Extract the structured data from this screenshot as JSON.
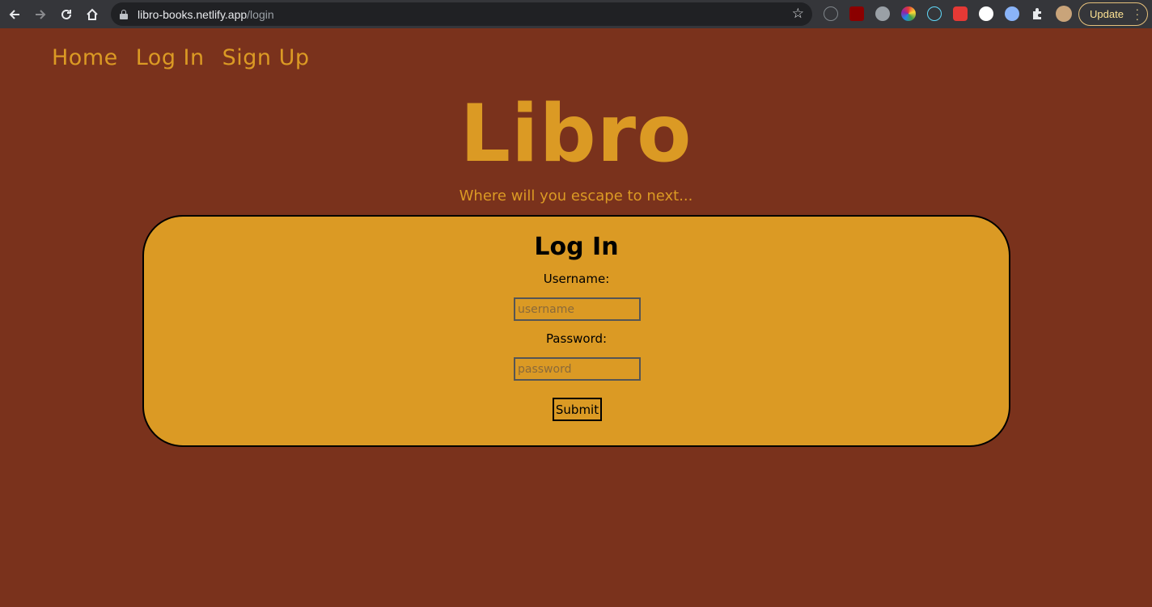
{
  "browser": {
    "url_host": "libro-books.netlify.app",
    "url_path": "/login",
    "update_label": "Update",
    "icons": [
      "back-icon",
      "forward-icon",
      "reload-icon",
      "home-icon",
      "lock-icon",
      "star-icon",
      "extensions-icon",
      "more-icon"
    ]
  },
  "nav": {
    "home": "Home",
    "login": "Log In",
    "signup": "Sign Up"
  },
  "header": {
    "brand": "Libro",
    "tagline": "Where will you escape to next..."
  },
  "login_form": {
    "title": "Log In",
    "username_label": "Username:",
    "username_placeholder": "username",
    "password_label": "Password:",
    "password_placeholder": "password",
    "submit_label": "Submit"
  },
  "colors": {
    "page_bg": "#7a321c",
    "accent": "#db9a24",
    "text": "#000000"
  }
}
